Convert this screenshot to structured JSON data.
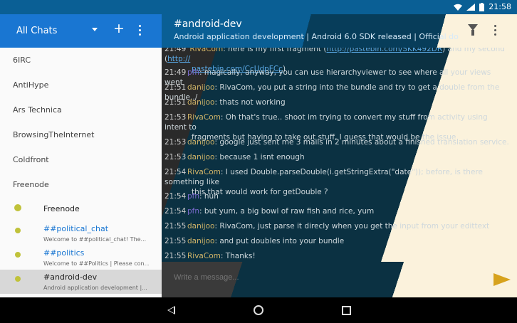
{
  "status": {
    "time": "21:58",
    "icons": [
      "wifi-icon",
      "signal-icon",
      "battery-icon"
    ]
  },
  "drawer": {
    "title": "All Chats",
    "servers": [
      "6IRC",
      "AntiHype",
      "Ars Technica",
      "BrowsingTheInternet",
      "Coldfront",
      "Freenode"
    ],
    "channels": [
      {
        "name": "Freenode",
        "sub": ""
      },
      {
        "name": "##political_chat",
        "sub": "Welcome to ##political_chat! The..."
      },
      {
        "name": "##politics",
        "sub": "Welcome to ##Politics | Please con..."
      },
      {
        "name": "#android-dev",
        "sub": "Android application development |..."
      }
    ]
  },
  "toolbar": {
    "title": "#android-dev",
    "topic": "Android application development | Android 6.0 SDK released | Official doc..."
  },
  "messages": [
    {
      "time": "21:49",
      "nick": "RivaCom",
      "text": ": here is my first fragment",
      "link": "http://pastebin.com/SKK492DR",
      "after": " and my second ",
      "link2": "http://",
      "cont": "pastebin.com/CcUdpFCc"
    },
    {
      "time": "21:49",
      "nick": "pfn",
      "text": ": magically, anyway, you can use hierarchyviewer to see where all your views went"
    },
    {
      "time": "21:51",
      "nick": "danijoo",
      "text": ": RivaCom, you put a string into the bundle and try to get a double from the bundle../"
    },
    {
      "time": "21:51",
      "nick": "danijoo",
      "text": ": thats not working"
    },
    {
      "time": "21:53",
      "nick": "RivaCom",
      "text": ": Oh that's true.. shoot im trying to convert my stuff from activity using intent to",
      "cont": "fragments but having to take out stuff, I guess that would be the issue"
    },
    {
      "time": "21:53",
      "nick": "danijoo",
      "text": ": google just sent me 3 mails in 2 minutes about a finished translation service."
    },
    {
      "time": "21:53",
      "nick": "danijoo",
      "text": ": because 1 isnt enough"
    },
    {
      "time": "21:54",
      "nick": "RivaCom",
      "text": ": I used Double.parseDouble(i.getStringExtra(\"date\")); before, is there something like",
      "cont": "this that would work for getDouble ?"
    },
    {
      "time": "21:54",
      "nick": "pfn",
      "text": ": huh"
    },
    {
      "time": "21:54",
      "nick": "pfn",
      "text": ": but yum, a big bowl of raw fish and rice, yum"
    },
    {
      "time": "21:55",
      "nick": "danijoo",
      "text": ": RivaCom, just parse it direcly when you get the input from your edittext"
    },
    {
      "time": "21:55",
      "nick": "danijoo",
      "text": ": and put doubles into your bundle"
    },
    {
      "time": "21:55",
      "nick": "RivaCom",
      "text": ": Thanks!"
    }
  ],
  "input": {
    "placeholder": "Write a message..."
  }
}
